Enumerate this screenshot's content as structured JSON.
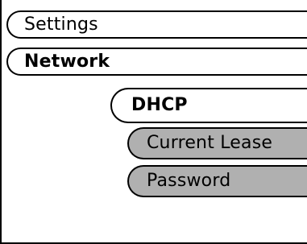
{
  "menu": {
    "settings_label": "Settings",
    "network_label": "Network",
    "dhcp_label": "DHCP",
    "current_lease_label": "Current Lease",
    "password_label": "Password"
  },
  "colors": {
    "background": "#ffffff",
    "outline": "#000000",
    "submenu_fill": "#b0b0b0"
  }
}
